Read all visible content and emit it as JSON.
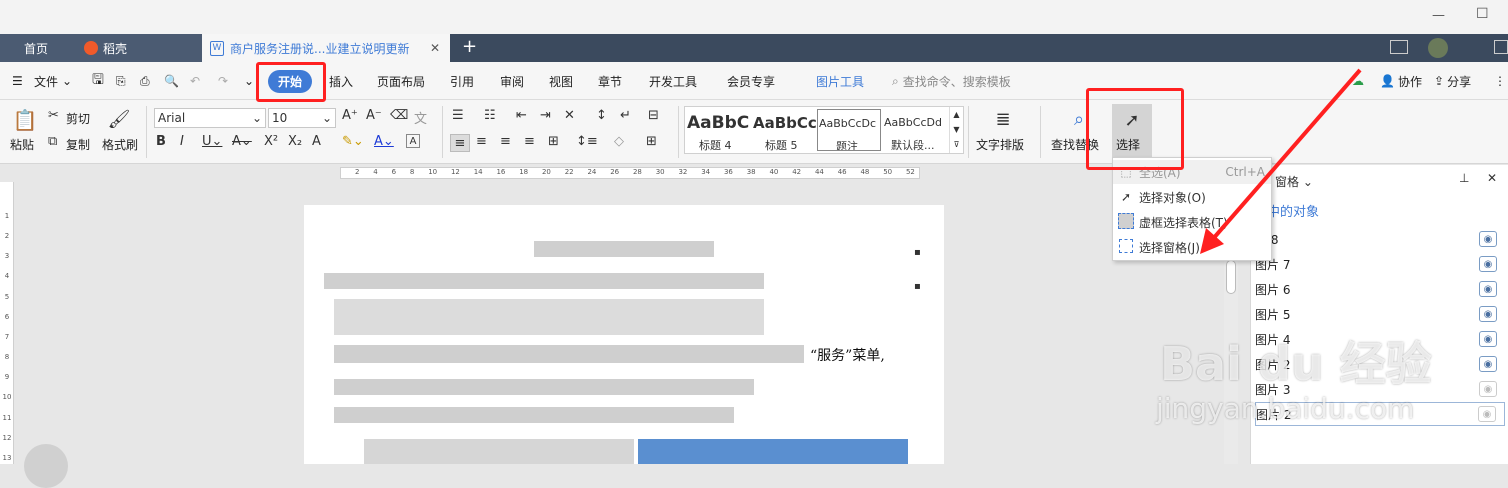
{
  "window": {
    "minimize": "—",
    "maximize": "☐"
  },
  "tabs": [
    {
      "label": "首页"
    },
    {
      "label": "稻壳"
    },
    {
      "label": "商户服务注册说...业建立说明更新"
    }
  ],
  "tab_close": "✕",
  "new_tab": "+",
  "menu": {
    "file": "文件",
    "start": "开始",
    "items": [
      "插入",
      "页面布局",
      "引用",
      "审阅",
      "视图",
      "章节",
      "开发工具",
      "会员专享"
    ],
    "picture_tools": "图片工具",
    "search": "查找命令、搜索模板",
    "collab": "协作",
    "share": "分享"
  },
  "ribbon": {
    "paste": "粘贴",
    "cut": "剪切",
    "copy": "复制",
    "format_painter": "格式刷",
    "font": "Arial",
    "size": "10",
    "styles": [
      {
        "preview": "AaBbC",
        "label": "标题 4"
      },
      {
        "preview": "AaBbCcI",
        "label": "标题 5"
      },
      {
        "preview": "AaBbCcDc",
        "label": "题注"
      },
      {
        "preview": "AaBbCcDd",
        "label": "默认段..."
      }
    ],
    "text_layout": "文字排版",
    "find_replace": "查找替换",
    "select": "选择"
  },
  "ruler_ticks": [
    "2",
    "4",
    "6",
    "8",
    "10",
    "12",
    "14",
    "16",
    "18",
    "20",
    "22",
    "24",
    "26",
    "28",
    "30",
    "32",
    "34",
    "36",
    "38",
    "40",
    "42",
    "44",
    "46",
    "48",
    "50",
    "52"
  ],
  "vruler": [
    "1",
    "2",
    "3",
    "4",
    "5",
    "6",
    "7",
    "8",
    "9",
    "10",
    "11",
    "12",
    "13"
  ],
  "doc": {
    "visible_text": "“服务”菜单,"
  },
  "pane": {
    "title": "窗格",
    "subtitle": "中的对象",
    "items": [
      "片 8",
      "图片 7",
      "图片 6",
      "图片 5",
      "图片 4",
      "图片 2",
      "图片 3",
      "图片 2"
    ]
  },
  "dropdown": {
    "items": [
      {
        "label": "全选(A)",
        "shortcut": "Ctrl+A"
      },
      {
        "label": "选择对象(O)",
        "shortcut": ""
      },
      {
        "label": "虚框选择表格(T)",
        "shortcut": ""
      },
      {
        "label": "选择窗格(J)",
        "shortcut": ""
      }
    ]
  },
  "watermark": {
    "logo": "Bai du 经验",
    "url": "jingyan.baidu.com"
  },
  "colors": {
    "tabbar": "#3b4a5e",
    "accent": "#3f7bd6",
    "annotation": "#ff2020"
  }
}
